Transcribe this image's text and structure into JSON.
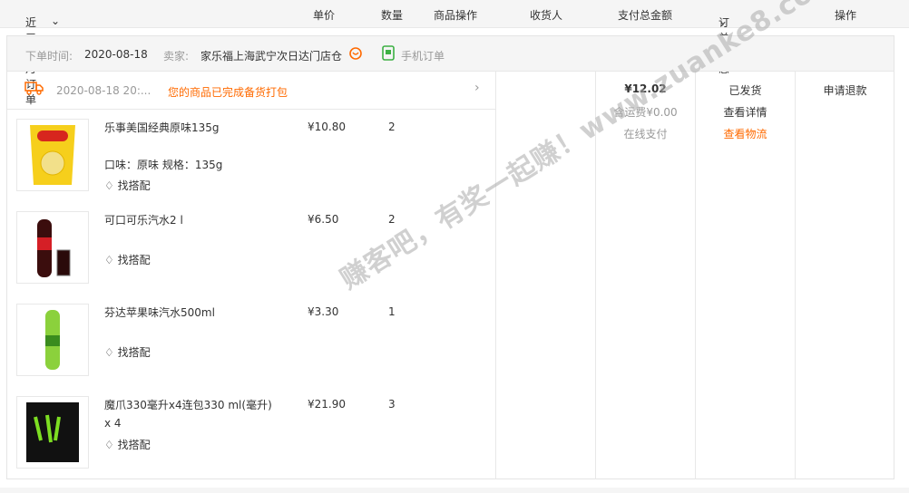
{
  "header": {
    "filter": "近三个月订单",
    "col_price": "单价",
    "col_qty": "数量",
    "col_item_ops": "商品操作",
    "col_receiver": "收货人",
    "col_total": "支付总金额",
    "col_status": "订单状态",
    "col_ops": "操作"
  },
  "order": {
    "order_time_label": "下单时间:",
    "order_time": "2020-08-18",
    "seller_label": "卖家:",
    "seller": "家乐福上海武宁次日达门店仓",
    "source": "手机订单",
    "logistics_time": "2020-08-18 20:...",
    "logistics_msg": "您的商品已完成备货打包",
    "total": "¥12.02",
    "shipping": "含运费¥0.00",
    "pay_method": "在线支付",
    "status": "已发货",
    "view_detail": "查看详情",
    "view_logistics": "查看物流",
    "refund": "申请退款"
  },
  "items": [
    {
      "name": "乐事美国经典原味135g",
      "spec": "口味：原味  规格：135g",
      "price": "¥10.80",
      "qty": "2",
      "match": "找搭配"
    },
    {
      "name": "可口可乐汽水2 l",
      "spec": "",
      "price": "¥6.50",
      "qty": "2",
      "match": "找搭配"
    },
    {
      "name": "芬达苹果味汽水500ml",
      "spec": "",
      "price": "¥3.30",
      "qty": "1",
      "match": "找搭配"
    },
    {
      "name": "魔爪330毫升x4连包330 ml(毫升) x 4",
      "spec": "",
      "price": "¥21.90",
      "qty": "3",
      "match": "找搭配"
    }
  ],
  "watermark": "赚客吧，有奖一起赚！www.zuanke8.com",
  "colors": {
    "accent": "#ff6a00",
    "muted": "#999999"
  }
}
